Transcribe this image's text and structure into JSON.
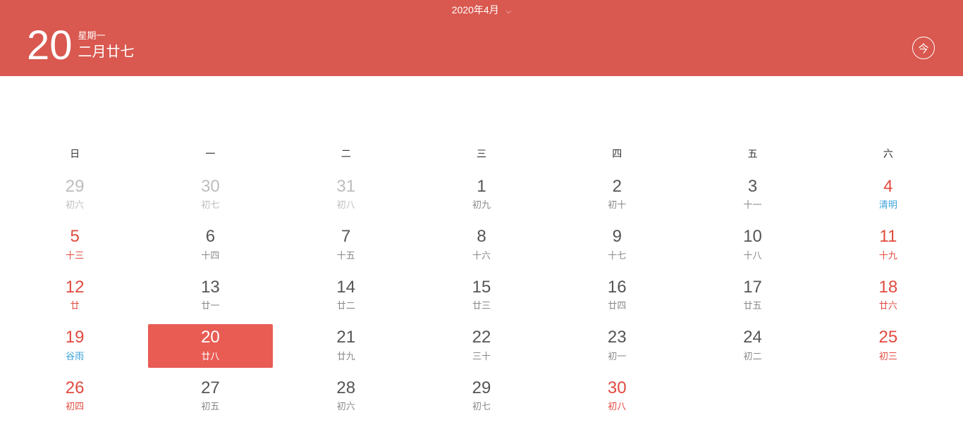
{
  "header": {
    "month_label": "2020年4月",
    "big_date": "20",
    "weekday": "星期一",
    "lunar": "二月廿七",
    "today_label": "今"
  },
  "weekdays": [
    "日",
    "一",
    "二",
    "三",
    "四",
    "五",
    "六"
  ],
  "days": [
    {
      "num": "29",
      "sub": "初六",
      "style": "muted"
    },
    {
      "num": "30",
      "sub": "初七",
      "style": "muted"
    },
    {
      "num": "31",
      "sub": "初八",
      "style": "muted"
    },
    {
      "num": "1",
      "sub": "初九",
      "style": "normal"
    },
    {
      "num": "2",
      "sub": "初十",
      "style": "normal"
    },
    {
      "num": "3",
      "sub": "十一",
      "style": "normal"
    },
    {
      "num": "4",
      "sub": "清明",
      "style": "weekend term-sub"
    },
    {
      "num": "5",
      "sub": "十三",
      "style": "weekend"
    },
    {
      "num": "6",
      "sub": "十四",
      "style": "normal"
    },
    {
      "num": "7",
      "sub": "十五",
      "style": "normal"
    },
    {
      "num": "8",
      "sub": "十六",
      "style": "normal"
    },
    {
      "num": "9",
      "sub": "十七",
      "style": "normal"
    },
    {
      "num": "10",
      "sub": "十八",
      "style": "normal"
    },
    {
      "num": "11",
      "sub": "十九",
      "style": "weekend"
    },
    {
      "num": "12",
      "sub": "廿",
      "style": "weekend"
    },
    {
      "num": "13",
      "sub": "廿一",
      "style": "normal"
    },
    {
      "num": "14",
      "sub": "廿二",
      "style": "normal"
    },
    {
      "num": "15",
      "sub": "廿三",
      "style": "normal"
    },
    {
      "num": "16",
      "sub": "廿四",
      "style": "normal"
    },
    {
      "num": "17",
      "sub": "廿五",
      "style": "normal"
    },
    {
      "num": "18",
      "sub": "廿六",
      "style": "weekend"
    },
    {
      "num": "19",
      "sub": "谷雨",
      "style": "weekend term-sub"
    },
    {
      "num": "20",
      "sub": "廿八",
      "style": "selected"
    },
    {
      "num": "21",
      "sub": "廿九",
      "style": "normal"
    },
    {
      "num": "22",
      "sub": "三十",
      "style": "normal"
    },
    {
      "num": "23",
      "sub": "初一",
      "style": "normal"
    },
    {
      "num": "24",
      "sub": "初二",
      "style": "normal"
    },
    {
      "num": "25",
      "sub": "初三",
      "style": "weekend"
    },
    {
      "num": "26",
      "sub": "初四",
      "style": "weekend"
    },
    {
      "num": "27",
      "sub": "初五",
      "style": "normal"
    },
    {
      "num": "28",
      "sub": "初六",
      "style": "normal"
    },
    {
      "num": "29",
      "sub": "初七",
      "style": "normal"
    },
    {
      "num": "30",
      "sub": "初八",
      "style": "holiday"
    }
  ]
}
